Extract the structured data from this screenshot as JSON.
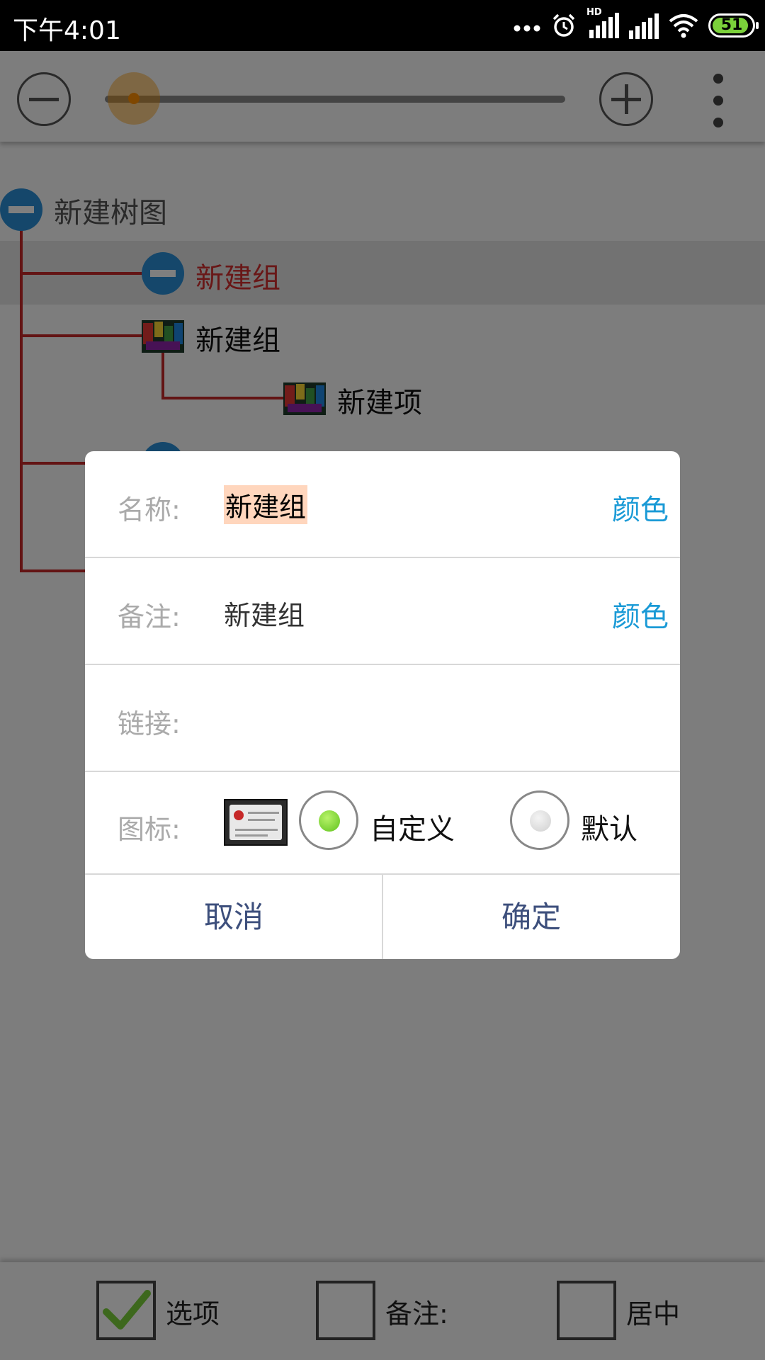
{
  "status_bar": {
    "time": "下午4:01",
    "network_badge": "HD",
    "battery_level": "51",
    "icons": [
      "more-dots-icon",
      "alarm-icon",
      "signal-hd-icon",
      "signal-icon",
      "wifi-icon",
      "battery-icon"
    ]
  },
  "toolbar": {
    "zoom_out_icon": "minus-circle-icon",
    "zoom_in_icon": "plus-circle-icon",
    "zoom_slider_level": 0.06,
    "menu_icon": "more-vertical-icon"
  },
  "tree": {
    "root": "新建树图",
    "nodes": [
      {
        "label": "新建组",
        "selected": true
      },
      {
        "label": "新建组"
      },
      {
        "label": "新建项"
      }
    ]
  },
  "dialog": {
    "name_label": "名称:",
    "name_value": "新建组",
    "note_label": "备注:",
    "note_value": "新建组",
    "link_label": "链接:",
    "link_value": "",
    "icon_label": "图标:",
    "color_link": "颜色",
    "radio_custom": "自定义",
    "radio_default": "默认",
    "radio_selected": "自定义",
    "cancel": "取消",
    "confirm": "确定"
  },
  "bottom_bar": {
    "options_label": "选项",
    "options_checked": true,
    "note_label": "备注:",
    "note_checked": false,
    "center_label": "居中",
    "center_checked": false
  },
  "colors": {
    "accent_blue": "#2a8fd6",
    "link_blue": "#1a9ad6",
    "tree_line_red": "#c62828",
    "slider_orange": "#ff8f00",
    "check_green": "#7bd13a",
    "button_text": "#3d4f7c"
  }
}
